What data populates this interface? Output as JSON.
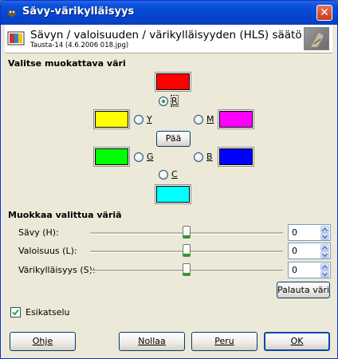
{
  "window": {
    "title": "Sävy-värikylläisyys"
  },
  "header": {
    "title": "Sävyn / valoisuuden / värikylläisyyden (HLS) säätö",
    "subtitle": "Tausta-14 (4.6.2006 018.jpg)"
  },
  "select_section": {
    "title": "Valitse muokattava väri",
    "colors": {
      "R": "#ff0000",
      "Y": "#ffff00",
      "M": "#ff00ff",
      "G": "#00ff00",
      "B": "#0000ff",
      "C": "#00ffff"
    },
    "radios": {
      "R": "R",
      "Y": "Y",
      "M": "M",
      "G": "G",
      "B": "B",
      "C": "C"
    },
    "selected": "R",
    "master_button": "Pää"
  },
  "adjust_section": {
    "title": "Muokkaa valittua väriä",
    "sliders": [
      {
        "label": "Sävy (H):",
        "value": "0",
        "fraction": 0.5
      },
      {
        "label": "Valoisuus (L):",
        "value": "0",
        "fraction": 0.5
      },
      {
        "label": "Värikylläisyys (S):",
        "value": "0",
        "fraction": 0.5
      }
    ],
    "reset_color_button": "Palauta väri"
  },
  "preview": {
    "label": "Esikatselu",
    "checked": true
  },
  "footer": {
    "help": "Ohje",
    "reset": "Nollaa",
    "cancel": "Peru",
    "ok": "OK"
  }
}
